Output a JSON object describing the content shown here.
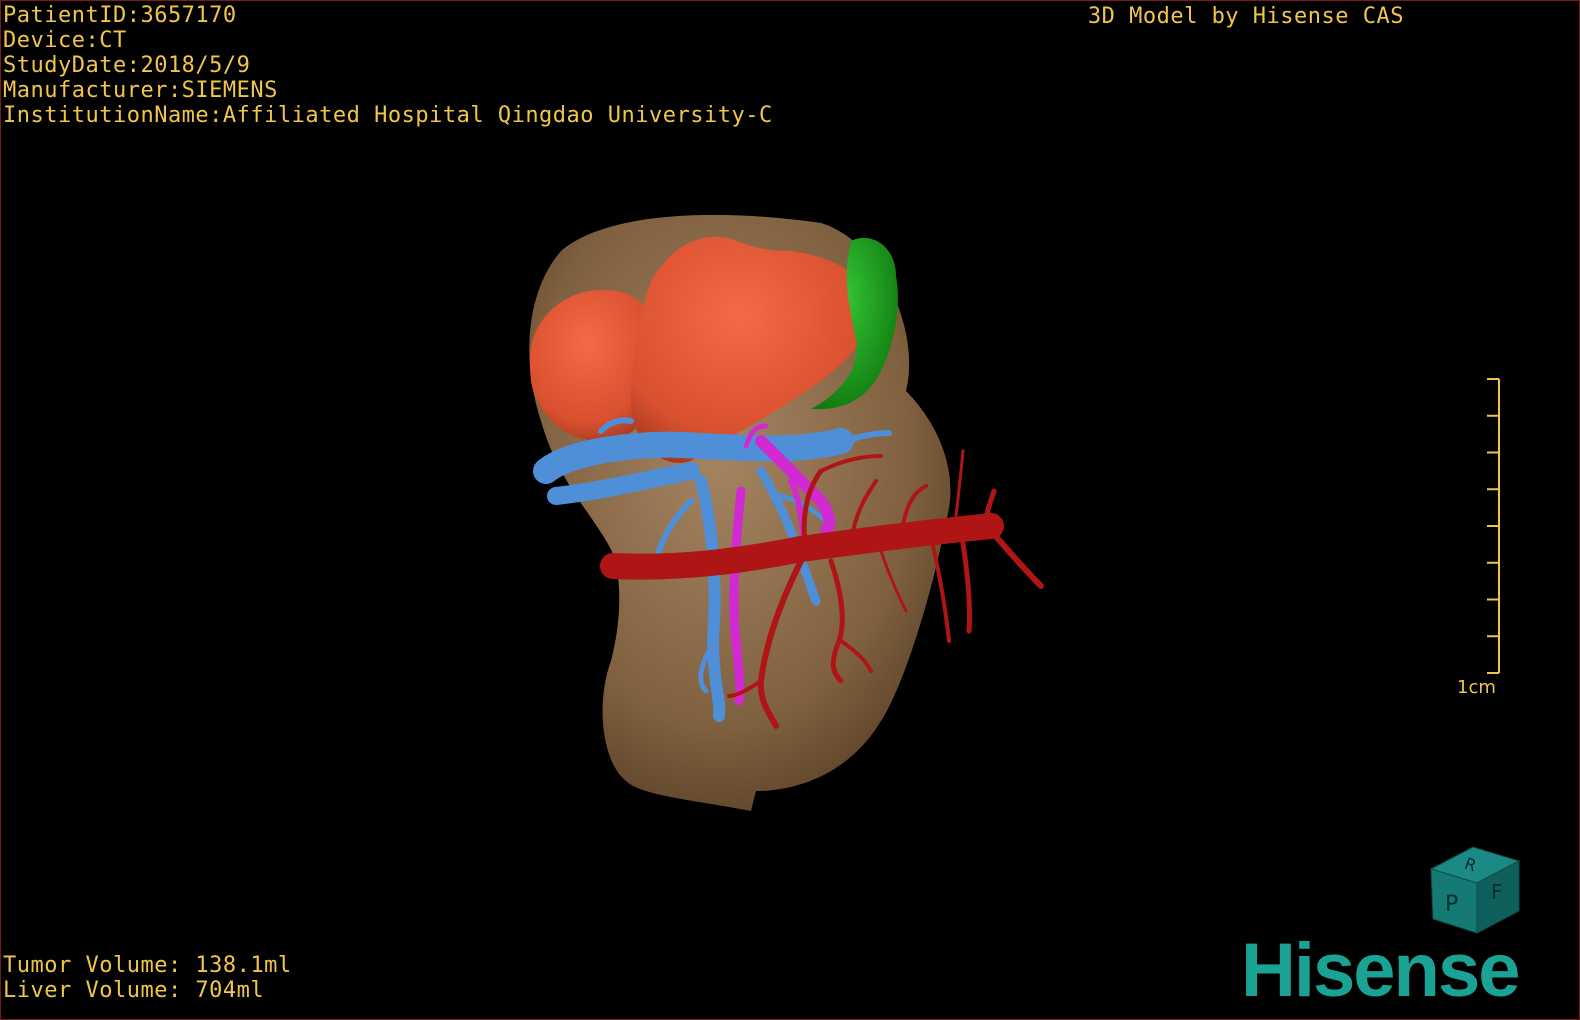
{
  "header": {
    "patient_id": "PatientID:3657170",
    "device": "Device:CT",
    "study_date": "StudyDate:2018/5/9",
    "manufacturer": "Manufacturer:SIEMENS",
    "institution": "InstitutionName:Affiliated Hospital Qingdao University-C",
    "model_credit": "3D Model by Hisense CAS"
  },
  "footer": {
    "tumor_volume": "Tumor Volume: 138.1ml",
    "liver_volume": "Liver Volume: 704ml"
  },
  "scale_bar": {
    "label": "1cm",
    "tick_count": 9
  },
  "orientation_cube": {
    "top_label": "R",
    "front_label": "P",
    "right_label": "F"
  },
  "brand": {
    "name": "Hisense",
    "color": "#1aa394"
  },
  "colors": {
    "overlay_text": "#f0c64a",
    "liver": "#8b6c4a",
    "tumor": "#e25a3a",
    "gallbladder": "#1fa61f",
    "portal_vein": "#4e8fd8",
    "hepatic_artery": "#d22ad2",
    "hepatic_vein": "#b01515"
  }
}
